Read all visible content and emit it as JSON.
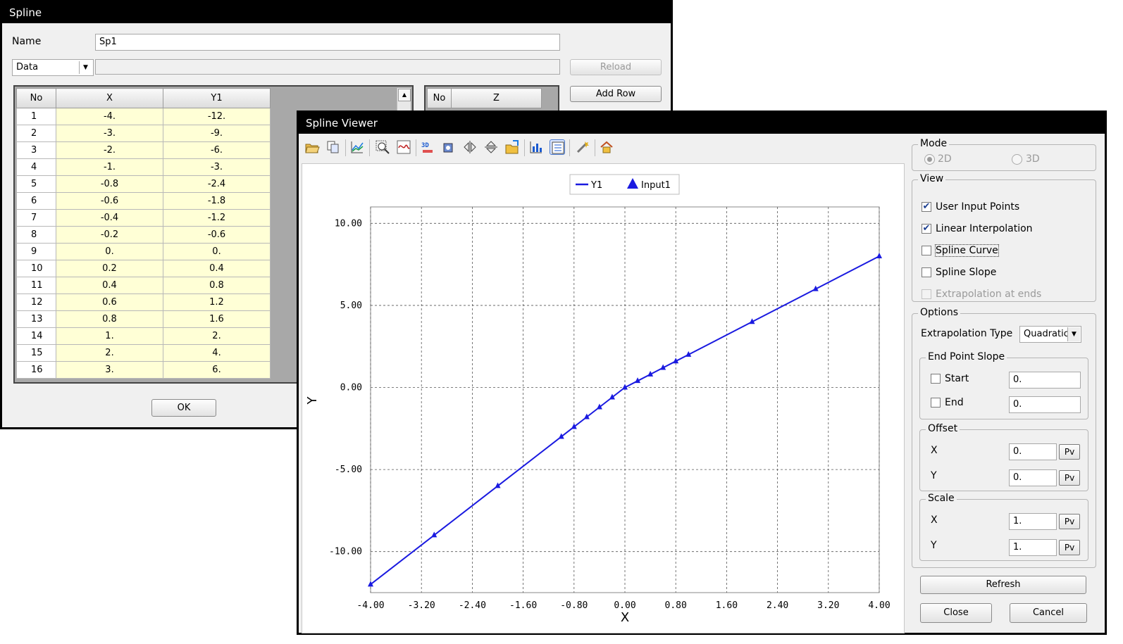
{
  "spline_dialog": {
    "title": "Spline",
    "name_label": "Name",
    "name_value": "Sp1",
    "source_value": "Data",
    "reload_label": "Reload",
    "add_row_label": "Add Row",
    "ok_label": "OK",
    "table": {
      "headers": [
        "No",
        "X",
        "Y1"
      ],
      "rows": [
        [
          "1",
          "-4.",
          "-12."
        ],
        [
          "2",
          "-3.",
          "-9."
        ],
        [
          "3",
          "-2.",
          "-6."
        ],
        [
          "4",
          "-1.",
          "-3."
        ],
        [
          "5",
          "-0.8",
          "-2.4"
        ],
        [
          "6",
          "-0.6",
          "-1.8"
        ],
        [
          "7",
          "-0.4",
          "-1.2"
        ],
        [
          "8",
          "-0.2",
          "-0.6"
        ],
        [
          "9",
          "0.",
          "0."
        ],
        [
          "10",
          "0.2",
          "0.4"
        ],
        [
          "11",
          "0.4",
          "0.8"
        ],
        [
          "12",
          "0.6",
          "1.2"
        ],
        [
          "13",
          "0.8",
          "1.6"
        ],
        [
          "14",
          "1.",
          "2."
        ],
        [
          "15",
          "2.",
          "4."
        ],
        [
          "16",
          "3.",
          "6."
        ]
      ]
    },
    "z_table": {
      "headers": [
        "No",
        "Z"
      ]
    }
  },
  "viewer": {
    "title": "Spline Viewer",
    "toolbar_icons": [
      "open-icon",
      "copy-icon",
      "chart-icon",
      "zoom-icon",
      "reset-icon",
      "3d-icon",
      "rotate-icon",
      "flip-horizontal-icon",
      "flip-vertical-icon",
      "export-icon",
      "statistics-icon",
      "list-icon",
      "settings-icon",
      "house-icon"
    ],
    "mode": {
      "title": "Mode",
      "options": [
        {
          "label": "2D",
          "selected": true
        },
        {
          "label": "3D",
          "selected": false
        }
      ]
    },
    "view": {
      "title": "View",
      "items": [
        {
          "label": "User Input Points",
          "checked": true,
          "enabled": true
        },
        {
          "label": "Linear Interpolation",
          "checked": true,
          "enabled": true
        },
        {
          "label": "Spline Curve",
          "checked": false,
          "enabled": true
        },
        {
          "label": "Spline Slope",
          "checked": false,
          "enabled": true
        },
        {
          "label": "Extrapolation at ends",
          "checked": false,
          "enabled": false
        }
      ]
    },
    "options": {
      "title": "Options",
      "extrapolation_label": "Extrapolation Type",
      "extrapolation_value": "Quadratic",
      "end_point_slope": {
        "title": "End Point Slope",
        "start_label": "Start",
        "start_value": "0.",
        "end_label": "End",
        "end_value": "0."
      },
      "offset": {
        "title": "Offset",
        "x_label": "X",
        "x_value": "0.",
        "y_label": "Y",
        "y_value": "0."
      },
      "scale": {
        "title": "Scale",
        "x_label": "X",
        "x_value": "1.",
        "y_label": "Y",
        "y_value": "1."
      },
      "pv_label": "Pv"
    },
    "refresh_label": "Refresh",
    "close_label": "Close",
    "cancel_label": "Cancel"
  },
  "chart_data": {
    "type": "line",
    "xlabel": "X",
    "ylabel": "Y",
    "xlim": [
      -4,
      4
    ],
    "ylim": [
      -12,
      11
    ],
    "xticks": [
      "-4.00",
      "-3.20",
      "-2.40",
      "-1.60",
      "-0.80",
      "0.00",
      "0.80",
      "1.60",
      "2.40",
      "3.20",
      "4.00"
    ],
    "xtick_values": [
      -4,
      -3.2,
      -2.4,
      -1.6,
      -0.8,
      0,
      0.8,
      1.6,
      2.4,
      3.2,
      4
    ],
    "yticks": [
      "10.00",
      "5.00",
      "0.00",
      "-5.00",
      "-10.00"
    ],
    "ytick_values": [
      10,
      5,
      0,
      -5,
      -10
    ],
    "grid": true,
    "legend": "top-center",
    "series": [
      {
        "name": "Y1",
        "color": "#1a1ae0",
        "x": [
          -4,
          -3,
          -2,
          -1,
          -0.8,
          -0.6,
          -0.4,
          -0.2,
          0,
          0.2,
          0.4,
          0.6,
          0.8,
          1,
          2,
          3,
          4
        ],
        "y": [
          -12,
          -9,
          -6,
          -3,
          -2.4,
          -1.8,
          -1.2,
          -0.6,
          0,
          0.4,
          0.8,
          1.2,
          1.6,
          2,
          4,
          6,
          8
        ]
      },
      {
        "name": "Input1",
        "color": "#1a1ae0",
        "x": [
          -4,
          -3,
          -2,
          -1,
          -0.8,
          -0.6,
          -0.4,
          -0.2,
          0,
          0.2,
          0.4,
          0.6,
          0.8,
          1,
          2,
          3,
          4
        ],
        "y": [
          -12,
          -9,
          -6,
          -3,
          -2.4,
          -1.8,
          -1.2,
          -0.6,
          0,
          0.4,
          0.8,
          1.2,
          1.6,
          2,
          4,
          6,
          8
        ]
      }
    ]
  }
}
